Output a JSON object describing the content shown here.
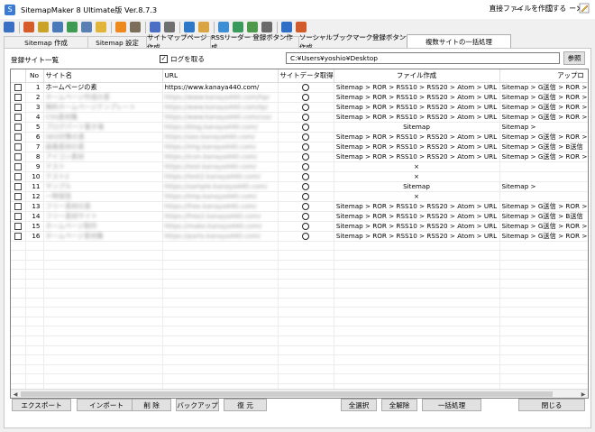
{
  "window": {
    "title": "SitemapMaker 8 Ultimate版  Ver.8.7.3",
    "minimize": "—",
    "maximize": "☐",
    "close": "✕"
  },
  "toolbar": {
    "icons": [
      {
        "name": "exit-icon",
        "color": "#3a6fc4"
      },
      {
        "name": "globe-icon",
        "color": "#d65a2a"
      },
      {
        "name": "folder-settings-icon",
        "color": "#c9a227"
      },
      {
        "name": "grid-icon",
        "color": "#4a7ab8"
      },
      {
        "name": "tree-icon",
        "color": "#3f9a54"
      },
      {
        "name": "document-icon",
        "color": "#5a7fb3"
      },
      {
        "name": "folder-icon",
        "color": "#e2b43a"
      },
      {
        "name": "rss-icon",
        "color": "#ee8a1d"
      },
      {
        "name": "tools-icon",
        "color": "#7b6f5c"
      },
      {
        "name": "edit-page-icon",
        "color": "#4a6fc4"
      },
      {
        "name": "tools-icon-2",
        "color": "#6f6f6f"
      },
      {
        "name": "ping-icon",
        "color": "#2e78c8"
      },
      {
        "name": "hand-icon",
        "color": "#d9a441"
      },
      {
        "name": "chat-icon",
        "color": "#3e8ed6"
      },
      {
        "name": "upload-icon",
        "color": "#3a9a5c"
      },
      {
        "name": "stats-icon",
        "color": "#4f9a4a"
      },
      {
        "name": "wrench-icon",
        "color": "#6a6a6a"
      },
      {
        "name": "info-icon",
        "color": "#2f6fc6"
      },
      {
        "name": "help-icon",
        "color": "#d25b2c"
      }
    ],
    "direct_create_label": "直接ファイルを作成する",
    "separator_after": "ー"
  },
  "tabs": [
    {
      "label": "Sitemap 作成",
      "width": 94
    },
    {
      "label": "Sitemap 設定",
      "width": 66
    },
    {
      "label": "サイトマップページ作成",
      "width": 72
    },
    {
      "label": "RSSリーダー 登録ボタン作成",
      "width": 99
    },
    {
      "label": "ソーシャルブックマーク登録ボタン作成",
      "width": 121
    },
    {
      "label": "複数サイトの一括処理",
      "width": 116,
      "active": true
    }
  ],
  "panel": {
    "list_label": "登録サイト一覧",
    "log_label": "ログを取る",
    "log_checked": true,
    "path_value": "C:¥Users¥yoshio¥Desktop",
    "browse_label": "参照"
  },
  "table": {
    "headers": {
      "no": "No",
      "site": "サイト名",
      "url": "URL",
      "get": "サイトデータ取得",
      "file": "ファイル作成",
      "upload": "アップロ"
    },
    "rows": [
      {
        "no": "1",
        "site": "ホームページの素",
        "url": "https://www.kanaya440.com/",
        "blurred": false,
        "file": "Sitemap > ROR > RSS10 > RSS20 > Atom > URL",
        "upload": "Sitemap > G送信 > ROR >"
      },
      {
        "no": "2",
        "site": "ホームページ作成の素",
        "url": "https://www.kanaya440.com/hp/",
        "blurred": true,
        "file": "Sitemap > ROR > RSS10 > RSS20 > Atom > URL",
        "upload": "Sitemap > G送信 > ROR >"
      },
      {
        "no": "3",
        "site": "無料ホームページテンプレート",
        "url": "https://www.kanaya440.com/tp/",
        "blurred": true,
        "file": "Sitemap > ROR > RSS10 > RSS20 > Atom > URL",
        "upload": "Sitemap > G送信 > ROR >"
      },
      {
        "no": "4",
        "site": "CSS素材集",
        "url": "https://www.kanaya440.com/css/",
        "blurred": true,
        "file": "Sitemap > ROR > RSS10 > RSS20 > Atom > URL",
        "upload": "Sitemap > G送信 > ROR >"
      },
      {
        "no": "5",
        "site": "ブログパーツ置き場",
        "url": "https://blog.kanaya440.com/",
        "blurred": true,
        "file": "Sitemap",
        "upload": "Sitemap >"
      },
      {
        "no": "6",
        "site": "SEO対策の素",
        "url": "https://seo.kanaya440.com/",
        "blurred": true,
        "file": "Sitemap > ROR > RSS10 > RSS20 > Atom > URL",
        "upload": "Sitemap > G送信 > ROR >"
      },
      {
        "no": "7",
        "site": "画像素材の素",
        "url": "https://img.kanaya440.com/",
        "blurred": true,
        "file": "Sitemap > ROR > RSS10 > RSS20 > Atom > URL",
        "upload": "Sitemap > G送信 > B送信"
      },
      {
        "no": "8",
        "site": "アイコン素材",
        "url": "https://icon.kanaya440.com/",
        "blurred": true,
        "file": "Sitemap > ROR > RSS10 > RSS20 > Atom > URL",
        "upload": "Sitemap > G送信 > ROR >"
      },
      {
        "no": "9",
        "site": "テスト",
        "url": "https://test.kanaya440.com/",
        "blurred": true,
        "file": "×",
        "upload": "×"
      },
      {
        "no": "10",
        "site": "テスト2",
        "url": "https://test2.kanaya440.com/",
        "blurred": true,
        "file": "×",
        "upload": "×"
      },
      {
        "no": "11",
        "site": "サンプル",
        "url": "https://sample.kanaya440.com/",
        "blurred": true,
        "file": "Sitemap",
        "upload": "Sitemap >"
      },
      {
        "no": "12",
        "site": "一時保管",
        "url": "https://tmp.kanaya440.com/",
        "blurred": true,
        "file": "×",
        "upload": "×"
      },
      {
        "no": "13",
        "site": "フリー素材の素",
        "url": "https://free.kanaya440.com/",
        "blurred": true,
        "file": "Sitemap > ROR > RSS10 > RSS20 > Atom > URL",
        "upload": "Sitemap > G送信 > ROR >"
      },
      {
        "no": "14",
        "site": "フリー素材サイト",
        "url": "https://free2.kanaya440.com/",
        "blurred": true,
        "file": "Sitemap > ROR > RSS10 > RSS20 > Atom > URL",
        "upload": "Sitemap > G送信 > B送信"
      },
      {
        "no": "15",
        "site": "ホームページ制作",
        "url": "https://make.kanaya440.com/",
        "blurred": true,
        "file": "Sitemap > ROR > RSS10 > RSS20 > Atom > URL",
        "upload": "Sitemap > G送信 > ROR >"
      },
      {
        "no": "16",
        "site": "ホームページ素材集",
        "url": "https://parts.kanaya440.com/",
        "blurred": true,
        "file": "Sitemap > ROR > RSS10 > RSS20 > Atom > URL",
        "upload": "Sitemap > G送信 > ROR >"
      }
    ]
  },
  "buttons": {
    "export": "エクスポート",
    "import": "インポート",
    "delete": "削 除",
    "backup": "バックアップ",
    "restore": "復 元",
    "select_all": "全選択",
    "deselect_all": "全解除",
    "batch": "一括処理",
    "close": "閉じる"
  }
}
